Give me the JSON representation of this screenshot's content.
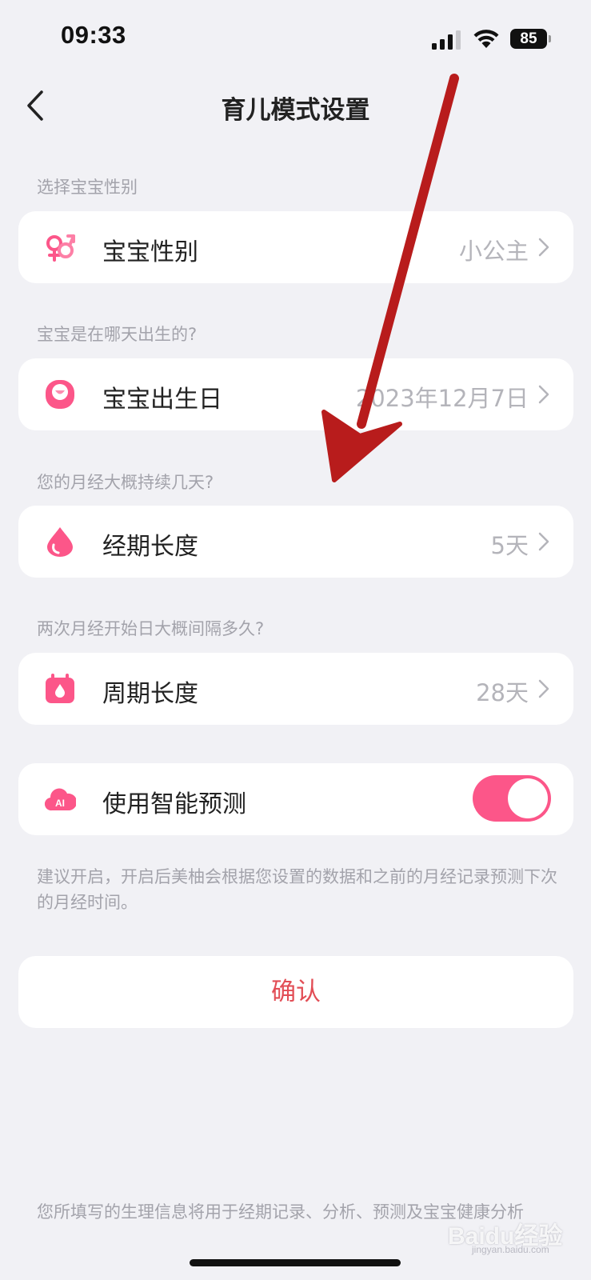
{
  "status_bar": {
    "time": "09:33",
    "battery": "85"
  },
  "nav": {
    "title": "育儿模式设置"
  },
  "sections": [
    {
      "label": "选择宝宝性别",
      "row_label": "宝宝性别",
      "value": "小公主",
      "icon": "gender-icon"
    },
    {
      "label": "宝宝是在哪天出生的?",
      "row_label": "宝宝出生日",
      "value": "2023年12月7日",
      "icon": "baby-face-icon"
    },
    {
      "label": "您的月经大概持续几天?",
      "row_label": "经期长度",
      "value": "5天",
      "icon": "drop-icon"
    },
    {
      "label": "两次月经开始日大概间隔多久?",
      "row_label": "周期长度",
      "value": "28天",
      "icon": "calendar-drop-icon"
    }
  ],
  "smart_prediction": {
    "label": "使用智能预测",
    "enabled": true,
    "icon": "ai-cloud-icon",
    "hint": "建议开启，开启后美柚会根据您设置的数据和之前的月经记录预测下次的月经时间。"
  },
  "confirm_label": "确认",
  "footer": "您所填写的生理信息将用于经期记录、分析、预测及宝宝健康分析",
  "watermark": {
    "brand": "Baidu经验",
    "url": "jingyan.baidu.com"
  },
  "colors": {
    "accent_pink": "#fc5689",
    "confirm_red": "#e24d55",
    "background": "#f1f1f5",
    "annotation_red": "#b81c1c"
  }
}
